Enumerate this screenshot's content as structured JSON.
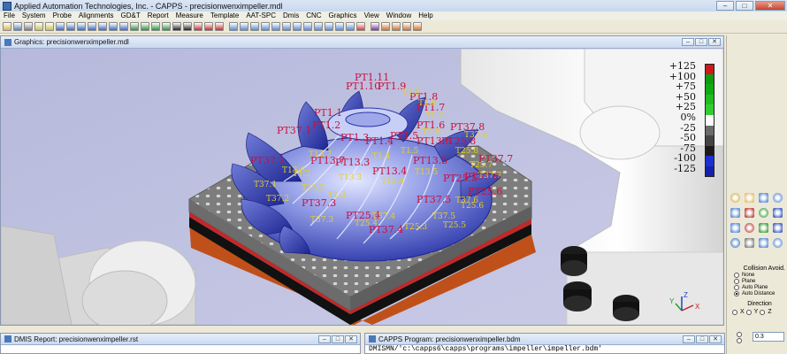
{
  "window": {
    "title": "Applied Automation Technologies, Inc. - CAPPS - precisionwenximpeller.mdl",
    "minimize": "–",
    "maximize": "□",
    "close": "✕"
  },
  "menu": [
    "File",
    "System",
    "Probe",
    "Alignments",
    "GD&T",
    "Report",
    "Measure",
    "Template",
    "AAT-SPC",
    "Dmis",
    "CNC",
    "Graphics",
    "View",
    "Window",
    "Help"
  ],
  "toolbar": {
    "icons": [
      {
        "name": "open-icon",
        "color": "#d9b25a"
      },
      {
        "name": "save-icon",
        "color": "#5a7fb8"
      },
      {
        "name": "print-icon",
        "color": "#7a7a7a"
      },
      {
        "name": "probe-icon",
        "color": "#c8c050"
      },
      {
        "name": "probe-change-icon",
        "color": "#c8c050"
      },
      {
        "name": "point-icon",
        "color": "#3c6cc0"
      },
      {
        "name": "line-icon",
        "color": "#3c6cc0"
      },
      {
        "name": "plane-icon",
        "color": "#3c6cc0"
      },
      {
        "name": "circle-icon",
        "color": "#3c6cc0"
      },
      {
        "name": "cylinder-icon",
        "color": "#3c6cc0"
      },
      {
        "name": "cone-icon",
        "color": "#3c6cc0"
      },
      {
        "name": "sphere-icon",
        "color": "#3c6cc0"
      },
      {
        "name": "slot-icon",
        "color": "#2f8f3f"
      },
      {
        "name": "curve-icon",
        "color": "#2f8f3f"
      },
      {
        "name": "surface-icon",
        "color": "#2f8f3f"
      },
      {
        "name": "edge-icon",
        "color": "#2f8f3f"
      },
      {
        "name": "gdt-flatness-icon",
        "color": "#222222"
      },
      {
        "name": "gdt-position-icon",
        "color": "#222222"
      },
      {
        "name": "gdt-profile-icon",
        "color": "#c03030"
      },
      {
        "name": "gdt-runout-icon",
        "color": "#c03030"
      },
      {
        "name": "report-icon",
        "color": "#c03030"
      },
      {
        "name": "sep"
      },
      {
        "name": "view-top-icon",
        "color": "#5a8ad0"
      },
      {
        "name": "view-front-icon",
        "color": "#5a8ad0"
      },
      {
        "name": "view-side-icon",
        "color": "#5a8ad0"
      },
      {
        "name": "view-iso-icon",
        "color": "#5a8ad0"
      },
      {
        "name": "shaded-icon",
        "color": "#5a8ad0"
      },
      {
        "name": "wireframe-icon",
        "color": "#5a8ad0"
      },
      {
        "name": "hidden-line-icon",
        "color": "#5a8ad0"
      },
      {
        "name": "zoom-in-icon",
        "color": "#5a8ad0"
      },
      {
        "name": "zoom-out-icon",
        "color": "#5a8ad0"
      },
      {
        "name": "zoom-fit-icon",
        "color": "#5a8ad0"
      },
      {
        "name": "pan-icon",
        "color": "#5a8ad0"
      },
      {
        "name": "rotate-icon",
        "color": "#5a8ad0"
      },
      {
        "name": "stop-icon",
        "color": "#d04040"
      },
      {
        "name": "sep"
      },
      {
        "name": "dmis-icon",
        "color": "#7a3a9a"
      },
      {
        "name": "record-icon",
        "color": "#d07030"
      },
      {
        "name": "play-icon",
        "color": "#d07030"
      },
      {
        "name": "step-icon",
        "color": "#d07030"
      },
      {
        "name": "cnc-icon",
        "color": "#d07030"
      }
    ]
  },
  "graphics_window": {
    "title": "Graphics: precisionwenximpeller.mdl",
    "labels_red": [
      "PT1.10",
      "PT1.9",
      "PT1.8",
      "PT1.7",
      "PT1.6",
      "PT1.5",
      "PT1.4",
      "PT1.3",
      "PT1.2",
      "PT1.1",
      "PT37.1",
      "PT37.2",
      "PT37.3",
      "PT25.4",
      "PT25.6",
      "PT25.8",
      "PT25.5",
      "PT37.5",
      "PT37.7",
      "PT37.4",
      "PT13.8",
      "PT13.5",
      "PT13.4",
      "PT13.3",
      "PT13.7",
      "PT37.8",
      "PT1.11",
      "PT37.6"
    ],
    "labels_yellow": [
      "T1.9",
      "T1.8",
      "T1.7",
      "T1.6",
      "T1.5",
      "T1.4",
      "T13.7",
      "T13.6",
      "T13.5",
      "T13.4",
      "T13.3",
      "T13.2",
      "T25.8",
      "T25.7",
      "T25.6",
      "T25.4",
      "T37.8",
      "T37.7",
      "T37.6",
      "T37.5",
      "T37.4",
      "T37.3",
      "T37.2",
      "T37.1",
      "T25.5",
      "T25.3",
      "T1.3",
      "T1.2"
    ],
    "scale_labels": [
      "+125",
      "+100",
      "+75",
      "+50",
      "+25",
      "0%",
      "-25",
      "-50",
      "-75",
      "-100",
      "-125"
    ],
    "scale_colors": [
      "#cc1a1a",
      "#119911",
      "#11aa11",
      "#22bb22",
      "#33cc33",
      "#ffffff",
      "#6a6a6a",
      "#444444",
      "#1a1a1a",
      "#1e2fd0",
      "#1620aa"
    ],
    "axis_labels": [
      "X",
      "Y",
      "Z"
    ]
  },
  "right_panel": {
    "icons": [
      "zoom-icon",
      "hand-icon",
      "magnify-icon",
      "rotate-icon",
      "probe-up-icon",
      "axis-x-icon",
      "axis-y-icon",
      "axis-z-icon",
      "probe-tip-icon",
      "axis-xy-icon",
      "axis-yz-icon",
      "axis-zx-icon",
      "globe-icon",
      "gear-icon",
      "arrow-icon",
      "grid-icon"
    ],
    "collision_header": "Collision Avoid.",
    "collision_options": [
      {
        "label": "None",
        "selected": false
      },
      {
        "label": "Plane",
        "selected": false
      },
      {
        "label": "Auto Plane",
        "selected": false
      },
      {
        "label": "Auto Distance",
        "selected": true
      }
    ],
    "direction_header": "Direction",
    "direction_options": [
      {
        "label": "X",
        "selected": false
      },
      {
        "label": "Y",
        "selected": false
      },
      {
        "label": "Z",
        "selected": false
      }
    ],
    "distance_value": "0.3"
  },
  "dmis_report": {
    "title": "DMIS Report: precisionwenximpeller.rst"
  },
  "capps_program": {
    "title": "CAPPS Program: precisionwenximpeller.bdm",
    "first_line": "DMISMN/'c:\\capps6\\capps\\programs\\impeller\\impeller.bdm'"
  }
}
